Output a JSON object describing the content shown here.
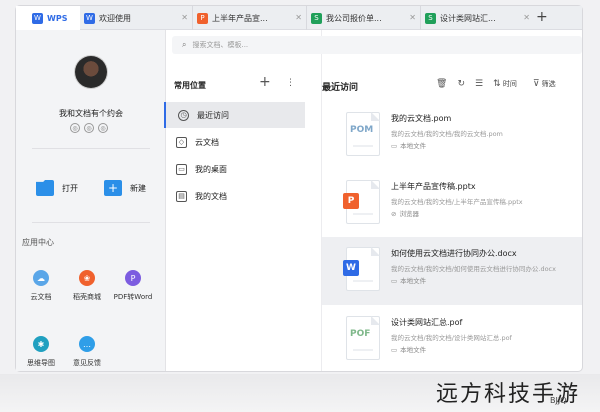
{
  "tabs": [
    {
      "label": "WPS",
      "color": "#2f6be6"
    },
    {
      "label": "欢迎使用",
      "color": "#2f6be6",
      "icon": "W"
    },
    {
      "label": "上半年产品宣...",
      "color": "#f0612d",
      "icon": "P"
    },
    {
      "label": "我公司报价单...",
      "color": "#20a05a",
      "icon": "S"
    },
    {
      "label": "设计类网站汇...",
      "color": "#20a05a",
      "icon": "S"
    }
  ],
  "user": {
    "name": "我和文档有个约会",
    "badges": [
      "◎",
      "◎",
      "◎"
    ]
  },
  "actions": {
    "open": "打开",
    "new": "新建"
  },
  "apps_title": "应用中心",
  "apps": [
    {
      "label": "云文档",
      "color": "#5aa6e8",
      "icon": "☁"
    },
    {
      "label": "稻壳商城",
      "color": "#f0612d",
      "icon": "❀"
    },
    {
      "label": "PDF转Word",
      "color": "#7c5ce0",
      "icon": "P"
    },
    {
      "label": "思维导图",
      "color": "#20a0c0",
      "icon": "✱"
    },
    {
      "label": "意见反馈",
      "color": "#2f9ee8",
      "icon": "…"
    }
  ],
  "search": {
    "placeholder": "搜索文档、模板..."
  },
  "nav": {
    "title": "常用位置",
    "items": [
      "最近访问",
      "云文档",
      "我的桌面",
      "我的文档"
    ]
  },
  "main": {
    "title": "最近访问",
    "toolbar": {
      "time": "时间",
      "filter": "筛选"
    }
  },
  "files": [
    {
      "name": "我的云文档.pom",
      "path": "我的云文档/我的文档/我的云文档.pom",
      "loc": "本地文件",
      "thumb": "POM",
      "badge_color": ""
    },
    {
      "name": "上半年产品宣传稿.pptx",
      "path": "我的云文档/我的文档/上半年产品宣传稿.pptx",
      "loc": "浏览器",
      "thumb": "P",
      "badge_color": "#f0612d"
    },
    {
      "name": "如何使用云文档进行协同办公.docx",
      "path": "我的云文档/我的文档/如何使用云文档进行协同办公.docx",
      "loc": "本地文件",
      "thumb": "W",
      "badge_color": "#2f6be6"
    },
    {
      "name": "设计类网站汇总.pof",
      "path": "我的云文档/我的文档/设计类网站汇总.pof",
      "loc": "本地文件",
      "thumb": "POF",
      "badge_color": ""
    }
  ],
  "watermark": "远方科技手游",
  "watermark_small": "BJJQ"
}
